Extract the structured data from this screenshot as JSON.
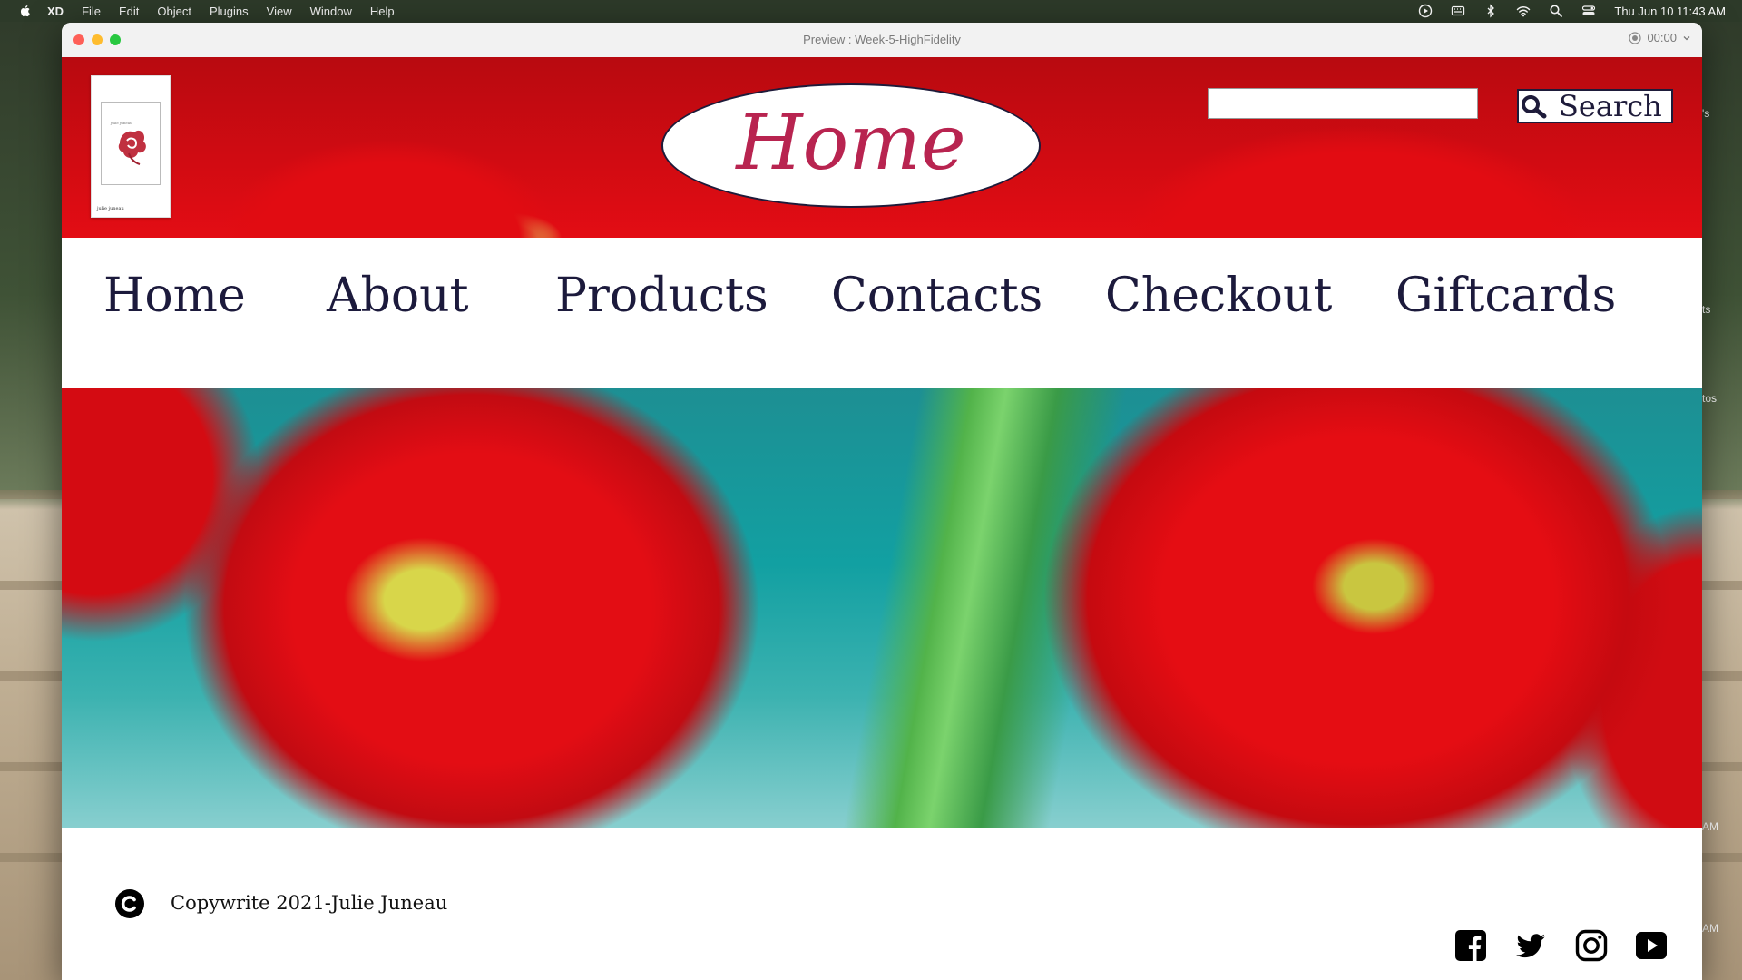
{
  "menubar": {
    "app": "XD",
    "items": [
      "File",
      "Edit",
      "Object",
      "Plugins",
      "View",
      "Window",
      "Help"
    ],
    "clock": "Thu Jun 10  11:43 AM"
  },
  "window": {
    "title": "Preview : Week-5-HighFidelity",
    "timer": "00:00"
  },
  "header": {
    "title": "Home",
    "search_placeholder": "",
    "search_label": "Search"
  },
  "logo": {
    "caption": "julie juneau"
  },
  "nav": {
    "items": [
      "Home",
      "About",
      "Products",
      "Contacts",
      "Checkout",
      "Giftcards"
    ]
  },
  "footer": {
    "copyright": "Copywrite 2021-Julie Juneau",
    "social": [
      "facebook-icon",
      "twitter-icon",
      "instagram-icon",
      "youtube-icon"
    ]
  },
  "desktop_peek": [
    "'s",
    "ts",
    "tos",
    "AM",
    "AM"
  ],
  "colors": {
    "nav_text": "#1c1a3c",
    "title_text": "#b82450",
    "menubar": "#2d3a29"
  }
}
